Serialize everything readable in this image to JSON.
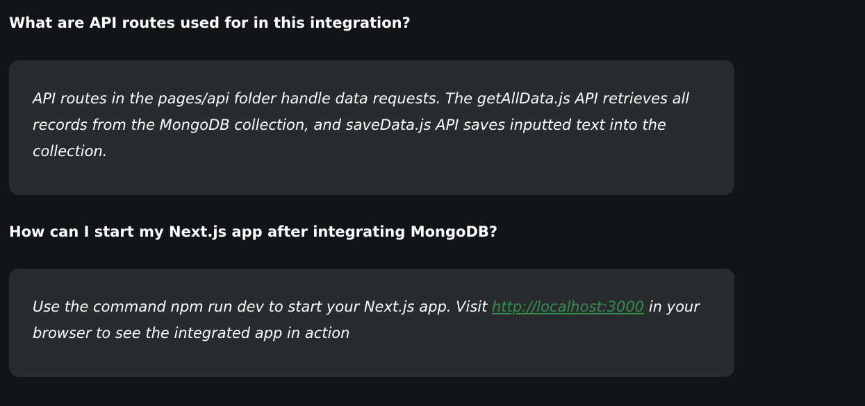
{
  "faqs": [
    {
      "question": "What are API routes used for in this integration?",
      "answer": "API routes in the pages/api folder handle data requests. The getAllData.js API retrieves all records from the MongoDB collection, and saveData.js API saves inputted text into the collection."
    },
    {
      "question": "How can I start my Next.js app after integrating MongoDB?",
      "answer_before_link": "Use the command npm run dev to start your Next.js app. Visit ",
      "answer_link": "http://localhost:3000",
      "answer_after_link": " in your browser to see the integrated app in action"
    }
  ],
  "colors": {
    "background": "#131417",
    "card": "#2a2b2e",
    "link": "#2f8f4e",
    "text": "#ffffff"
  }
}
